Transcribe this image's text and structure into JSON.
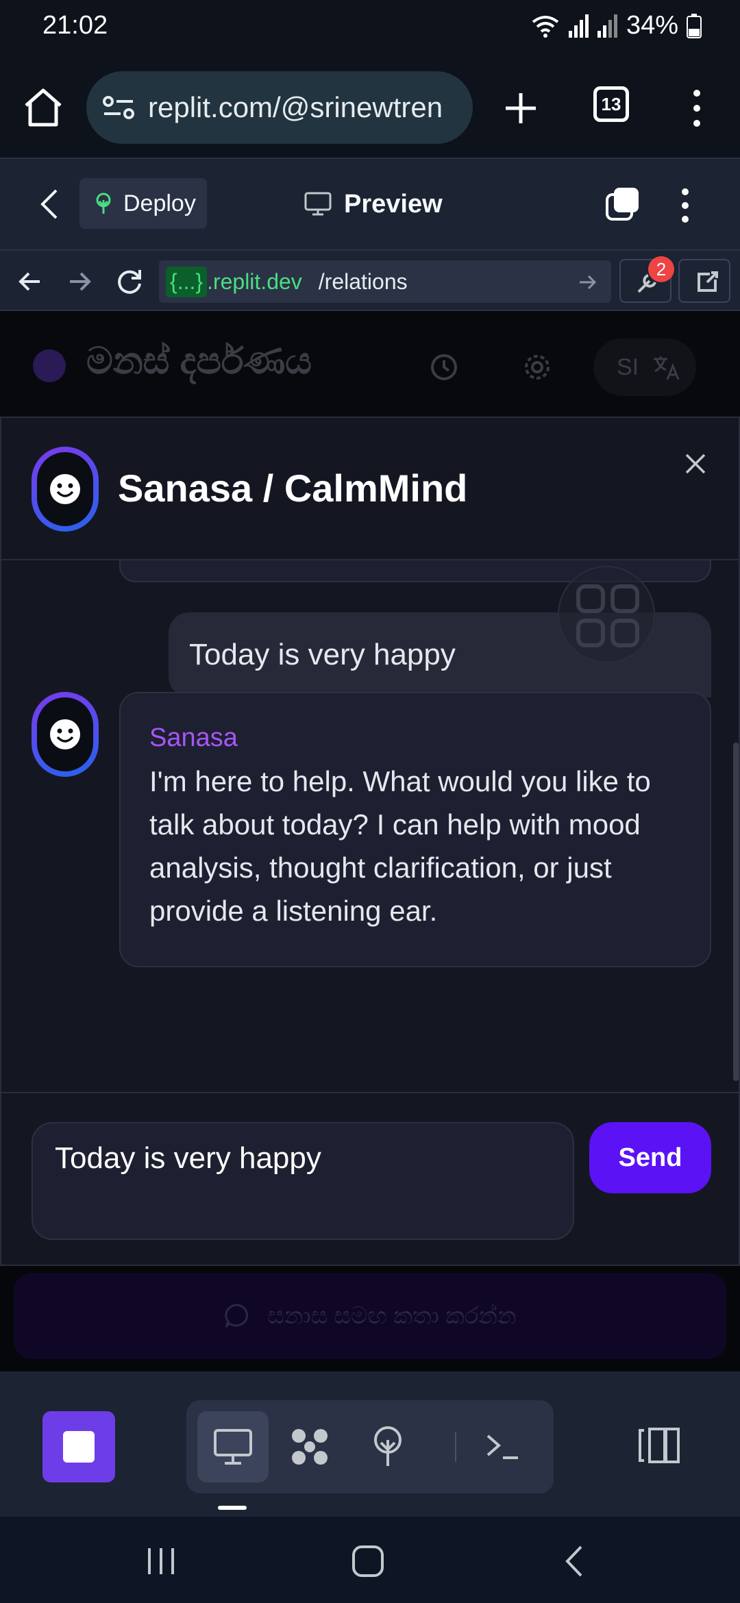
{
  "status_bar": {
    "time": "21:02",
    "battery": "34%"
  },
  "browser": {
    "url": "replit.com/@srinewtren",
    "tab_count": "13"
  },
  "replit_header": {
    "deploy_label": "Deploy",
    "preview_label": "Preview"
  },
  "preview_toolbar": {
    "host_chip": "{...}",
    "host": ".replit.dev",
    "path": "/relations",
    "badge_count": "2"
  },
  "app": {
    "title": "මනස් දර්පණය",
    "lang_code": "SI",
    "cta_label": "සනාස සමඟ කතා කරන්න"
  },
  "chat": {
    "title": "Sanasa / CalmMind",
    "messages": [
      {
        "role": "user",
        "text": "Today is very happy"
      },
      {
        "role": "bot",
        "sender": "Sanasa",
        "text": "I'm here to help. What would you like to talk about today? I can help with mood analysis, thought clarification, or just provide a listening ear."
      }
    ],
    "input_value": "Today is very happy",
    "send_label": "Send"
  },
  "icons": {
    "home": "home-icon",
    "site_settings": "site-settings-icon",
    "new_tab": "plus-icon",
    "back": "chevron-left-icon",
    "deploy": "deploy-icon",
    "preview": "monitor-icon",
    "refresh": "refresh-icon",
    "devtools": "wrench-icon",
    "open_external": "external-link-icon",
    "history": "history-icon",
    "settings": "gear-icon",
    "translate": "translate-icon",
    "close": "close-icon",
    "chat": "chat-bubble-icon",
    "stop": "stop-icon",
    "console": "terminal-icon"
  },
  "colors": {
    "accent_purple": "#5b12f5",
    "sender_name": "#a855f7",
    "replit_bg": "#1c2333",
    "host_green": "#4ade80"
  }
}
